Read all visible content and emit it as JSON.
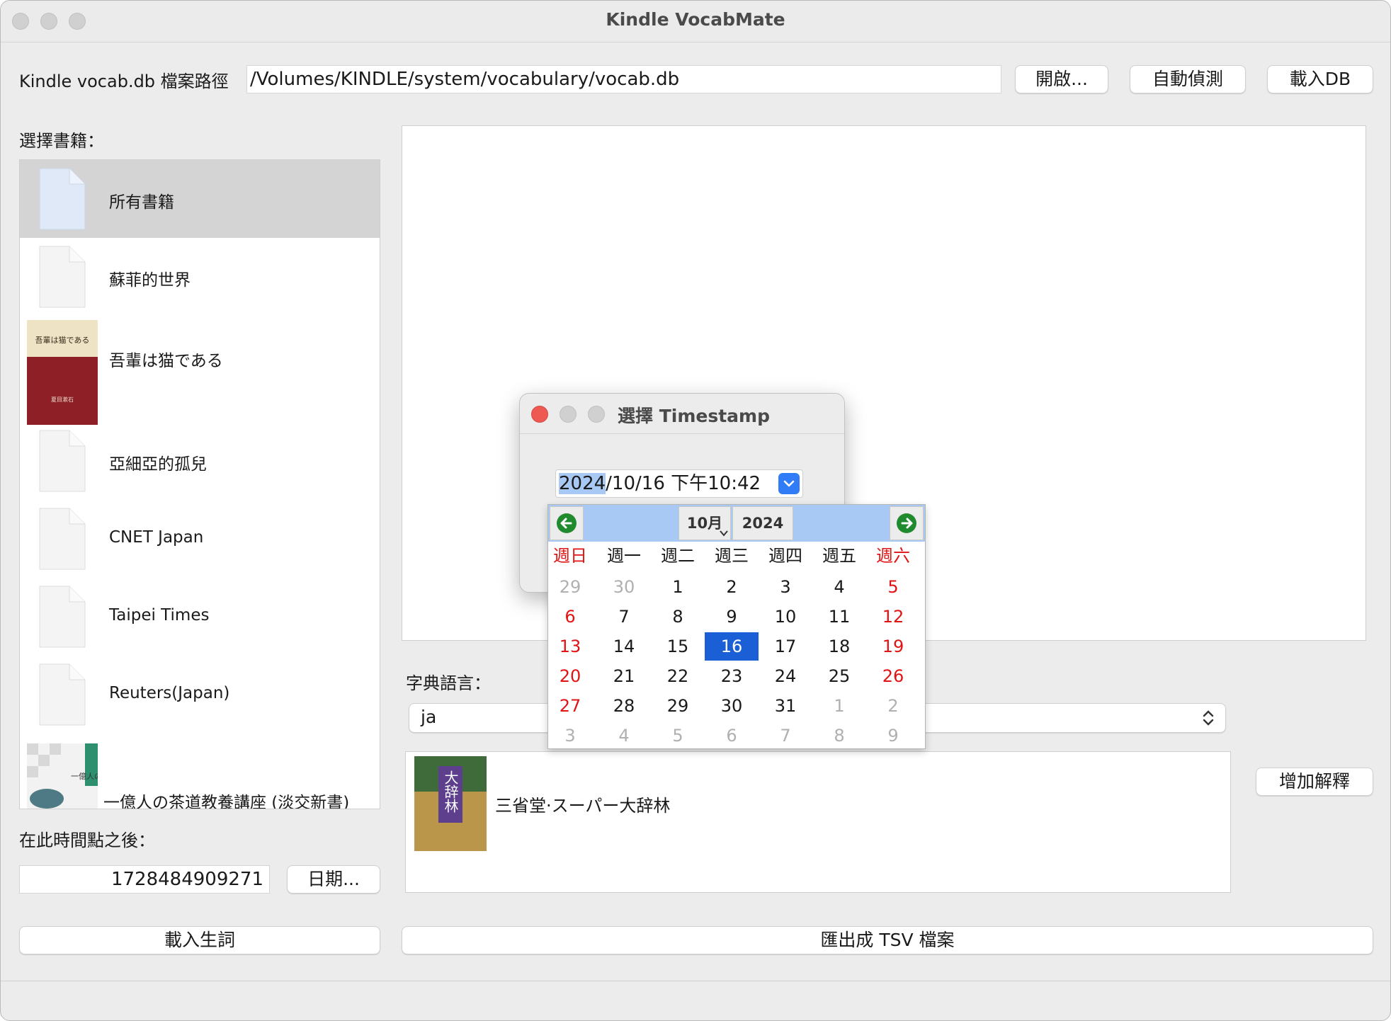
{
  "window": {
    "title": "Kindle VocabMate"
  },
  "path": {
    "label": "Kindle vocab.db 檔案路徑",
    "value": "/Volumes/KINDLE/system/vocabulary/vocab.db",
    "open_button": "開啟...",
    "autodetect_button": "自動偵測",
    "load_db_button": "載入DB"
  },
  "sidebar": {
    "select_books_label": "選擇書籍：",
    "books": [
      {
        "title": "所有書籍",
        "selected": true,
        "icon": "document-icon"
      },
      {
        "title": "蘇菲的世界",
        "icon": "document-icon"
      },
      {
        "title": "吾輩は猫である",
        "icon": "book-cover"
      },
      {
        "title": "亞細亞的孤兒",
        "icon": "document-icon"
      },
      {
        "title": "CNET Japan",
        "icon": "document-icon"
      },
      {
        "title": "Taipei Times",
        "icon": "document-icon"
      },
      {
        "title": "Reuters(Japan)",
        "icon": "document-icon"
      },
      {
        "title": "一億人の茶道教養講座 (淡交新書)",
        "icon": "book-cover"
      }
    ],
    "cover_texts": {
      "neko_top": "吾輩は猫である",
      "neko_author": "夏目漱石",
      "sado": "一億人の茶道教養講"
    },
    "after_time_label": "在此時間點之後：",
    "timestamp_value": "1728484909271",
    "date_button": "日期...",
    "load_words_button": "載入生詞"
  },
  "dictionary": {
    "language_label": "字典語言：",
    "language_value": "ja",
    "entries": [
      {
        "name": "三省堂·スーパー大辞林",
        "cover_text": "大辞林"
      }
    ],
    "add_button": "增加解釋",
    "export_button": "匯出成 TSV 檔案"
  },
  "dialog": {
    "title": "選擇 Timestamp",
    "date_year": "2024",
    "date_rest": "/10/16 下午10:42"
  },
  "calendar": {
    "month": "10月",
    "year": "2024",
    "weekdays": [
      "週日",
      "週一",
      "週二",
      "週三",
      "週四",
      "週五",
      "週六"
    ],
    "weeks": [
      [
        "29",
        "30",
        "1",
        "2",
        "3",
        "4",
        "5"
      ],
      [
        "6",
        "7",
        "8",
        "9",
        "10",
        "11",
        "12"
      ],
      [
        "13",
        "14",
        "15",
        "16",
        "17",
        "18",
        "19"
      ],
      [
        "20",
        "21",
        "22",
        "23",
        "24",
        "25",
        "26"
      ],
      [
        "27",
        "28",
        "29",
        "30",
        "31",
        "1",
        "2"
      ],
      [
        "3",
        "4",
        "5",
        "6",
        "7",
        "8",
        "9"
      ]
    ],
    "selected_day": "16",
    "colors": {
      "weekend": "#e01414",
      "selected": "#1a5fd6",
      "header": "#a9c9f5",
      "muted": "#b0b0b0"
    }
  }
}
